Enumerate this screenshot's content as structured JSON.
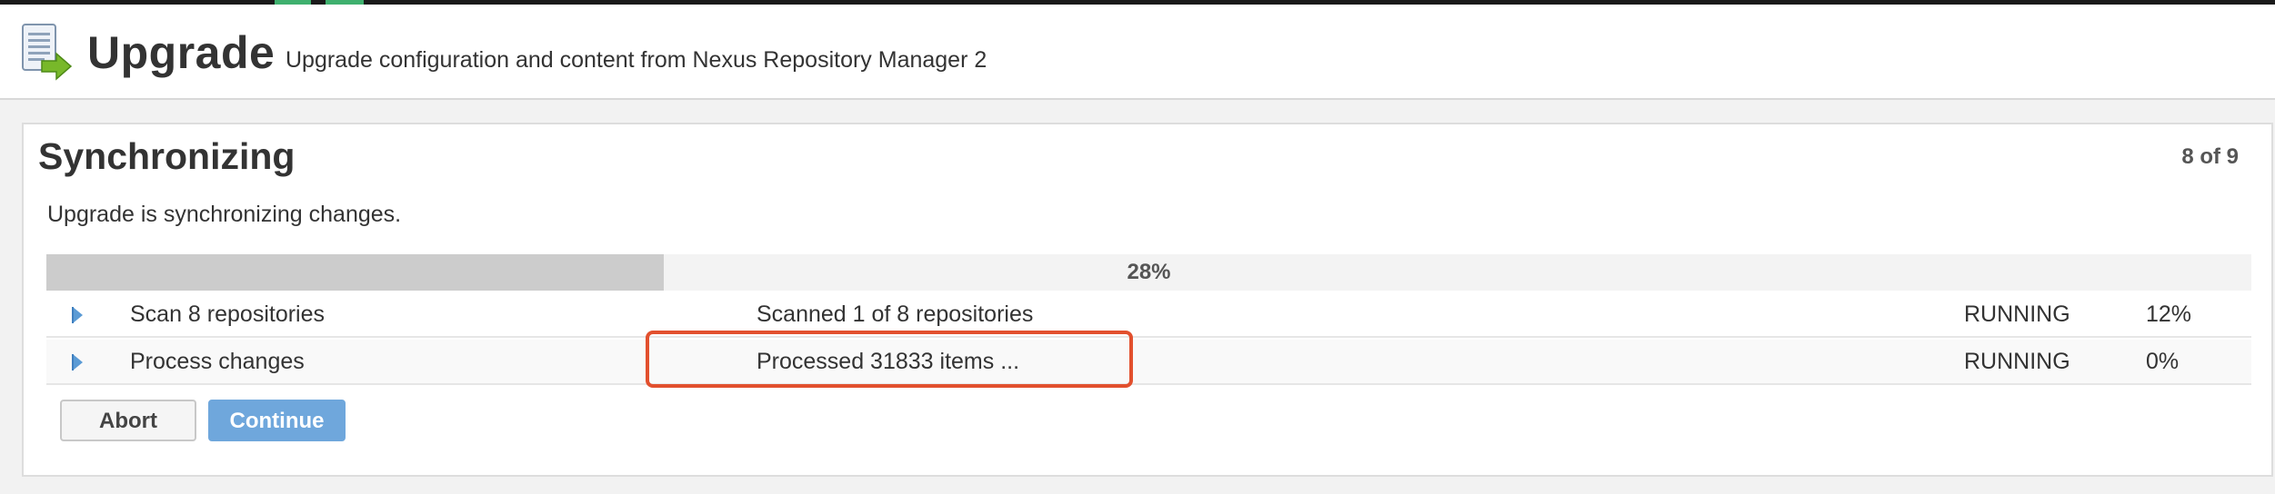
{
  "header": {
    "title": "Upgrade",
    "subtitle": "Upgrade configuration and content from Nexus Repository Manager 2",
    "icon": "upgrade-document-icon"
  },
  "panel": {
    "title": "Synchronizing",
    "step_counter": "8 of 9",
    "description": "Upgrade is synchronizing changes.",
    "progress": {
      "label": "28%",
      "value_percent": 28
    },
    "tasks": [
      {
        "name": "Scan 8 repositories",
        "detail": "Scanned 1 of 8 repositories",
        "status": "RUNNING",
        "percent": "12%"
      },
      {
        "name": "Process changes",
        "detail": "Processed 31833 items ...",
        "status": "RUNNING",
        "percent": "0%"
      }
    ],
    "buttons": {
      "abort": "Abort",
      "continue": "Continue"
    }
  },
  "colors": {
    "accent": "#6fa7dc",
    "highlight": "#e2502e",
    "tab_indicator": "#3fb06e",
    "progress_fill": "#cccccc"
  }
}
